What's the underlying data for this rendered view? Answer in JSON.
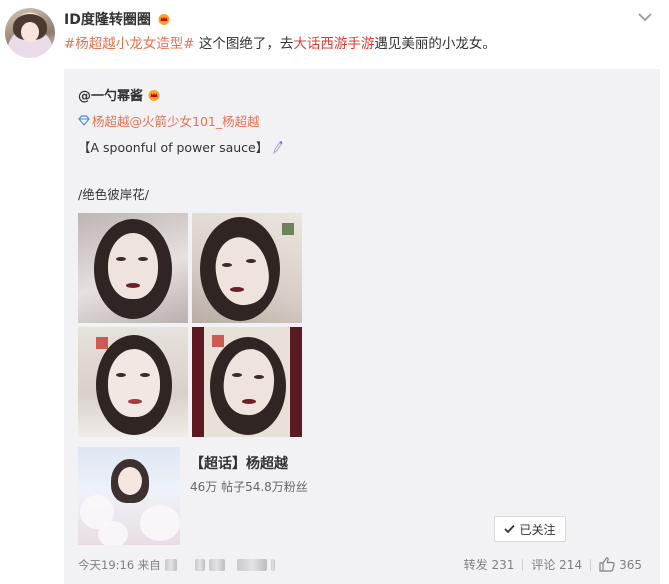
{
  "post": {
    "username": "ID度隆转圈圈",
    "text": {
      "topic": "#杨超越小龙女造型#",
      "part1": " 这个图绝了，去",
      "highlight": "大话西游手游",
      "part2": "遇见美丽的小龙女。"
    }
  },
  "repost": {
    "username": "@一勺幂酱",
    "mention": "杨超越@火箭少女101_杨超越",
    "line1": "【A spoonful of power sauce】",
    "line2": "/绝色彼岸花/",
    "photos": [
      {
        "alt": "photo-1"
      },
      {
        "alt": "photo-2"
      },
      {
        "alt": "photo-3"
      },
      {
        "alt": "photo-4"
      }
    ],
    "supertopic": {
      "title": "【超话】杨超越",
      "stats": "46万 帖子54.8万粉丝",
      "follow_label": "已关注"
    },
    "time": "今天19:16 来自",
    "actions": {
      "repost": "转发 231",
      "comment": "评论 214",
      "like": "365"
    }
  },
  "colors": {
    "link": "#eb7350",
    "highlight": "#e03c30",
    "crown": "#f5a623",
    "panel": "#f2f2f5"
  },
  "icons": [
    "crown-icon",
    "chevron-down-icon",
    "diamond-icon",
    "pen-icon",
    "check-icon",
    "thumb-up-icon"
  ]
}
